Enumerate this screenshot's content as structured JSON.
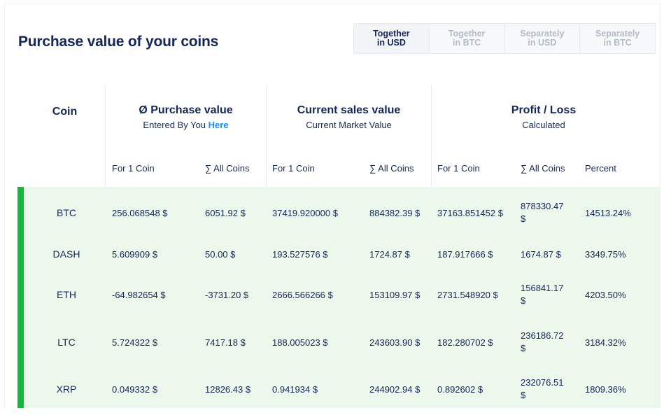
{
  "title": "Purchase value of your coins",
  "tabs": [
    {
      "line1": "Together",
      "line2": "in USD",
      "active": true
    },
    {
      "line1": "Together",
      "line2": "in BTC",
      "active": false
    },
    {
      "line1": "Separately",
      "line2": "in USD",
      "active": false
    },
    {
      "line1": "Separately",
      "line2": "in BTC",
      "active": false
    }
  ],
  "headers": {
    "coin": "Coin",
    "purchase": {
      "title": "Ø Purchase value",
      "subtitle": "Entered By You",
      "link": "Here"
    },
    "current": {
      "title": "Current sales value",
      "subtitle": "Current Market Value"
    },
    "profit": {
      "title": "Profit / Loss",
      "subtitle": "Calculated"
    }
  },
  "subheaders": {
    "p_one": "For 1 Coin",
    "p_all": "∑ All Coins",
    "c_one": "For 1 Coin",
    "c_all": "∑ All Coins",
    "pl_one": "For 1 Coin",
    "pl_all": "∑ All Coins",
    "pl_pct": "Percent"
  },
  "rows": [
    {
      "coin": "BTC",
      "p_one": "256.068548 $",
      "p_all": "6051.92 $",
      "c_one": "37419.920000 $",
      "c_all": "884382.39 $",
      "pl_one": "37163.851452 $",
      "pl_all": "878330.47 $",
      "pl_pct": "14513.24%"
    },
    {
      "coin": "DASH",
      "p_one": "5.609909 $",
      "p_all": "50.00 $",
      "c_one": "193.527576 $",
      "c_all": "1724.87 $",
      "pl_one": "187.917666 $",
      "pl_all": "1674.87 $",
      "pl_pct": "3349.75%"
    },
    {
      "coin": "ETH",
      "p_one": "-64.982654 $",
      "p_all": "-3731.20 $",
      "c_one": "2666.566266 $",
      "c_all": "153109.97 $",
      "pl_one": "2731.548920 $",
      "pl_all": "156841.17 $",
      "pl_pct": "4203.50%"
    },
    {
      "coin": "LTC",
      "p_one": "5.724322 $",
      "p_all": "7417.18 $",
      "c_one": "188.005023 $",
      "c_all": "243603.90 $",
      "pl_one": "182.280702 $",
      "pl_all": "236186.72 $",
      "pl_pct": "3184.32%"
    },
    {
      "coin": "XRP",
      "p_one": "0.049332 $",
      "p_all": "12826.43 $",
      "c_one": "0.941934 $",
      "c_all": "244902.94 $",
      "pl_one": "0.892602 $",
      "pl_all": "232076.51 $",
      "pl_pct": "1809.36%"
    }
  ],
  "colors": {
    "accent_green": "#14b83a",
    "row_bg": "#ecf8ec",
    "navy": "#14265a",
    "link_blue": "#1a8cff"
  }
}
